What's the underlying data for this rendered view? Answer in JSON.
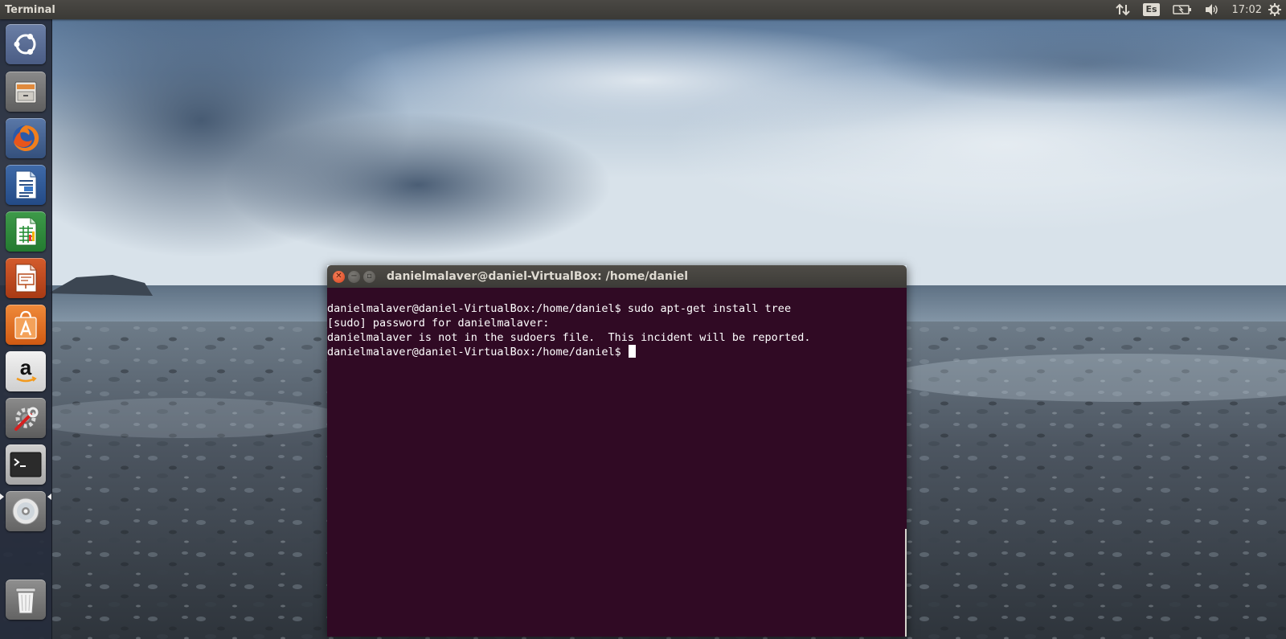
{
  "top_panel": {
    "app_title": "Terminal",
    "keyboard_layout": "Es",
    "clock": "17:02",
    "indicator_icons": [
      "network-updown-icon",
      "keyboard-layout-icon",
      "battery-icon",
      "volume-icon",
      "gear-icon"
    ]
  },
  "launcher": {
    "items": [
      {
        "name": "dash-home",
        "icon": "ubuntu-logo-icon"
      },
      {
        "name": "files",
        "icon": "file-cabinet-icon"
      },
      {
        "name": "firefox",
        "icon": "firefox-icon"
      },
      {
        "name": "libreoffice-writer",
        "icon": "writer-document-icon"
      },
      {
        "name": "libreoffice-calc",
        "icon": "calc-spreadsheet-icon"
      },
      {
        "name": "libreoffice-impress",
        "icon": "impress-presentation-icon"
      },
      {
        "name": "ubuntu-software",
        "icon": "shopping-bag-icon"
      },
      {
        "name": "amazon",
        "icon": "amazon-icon"
      },
      {
        "name": "system-settings",
        "icon": "settings-wrench-icon"
      },
      {
        "name": "terminal",
        "icon": "terminal-icon",
        "running": true
      },
      {
        "name": "optical-drive",
        "icon": "disc-icon"
      },
      {
        "name": "trash",
        "icon": "trash-icon"
      }
    ]
  },
  "terminal": {
    "window_title": "danielmalaver@daniel-VirtualBox: /home/daniel",
    "lines": [
      "danielmalaver@daniel-VirtualBox:/home/daniel$ sudo apt-get install tree",
      "[sudo] password for danielmalaver:",
      "danielmalaver is not in the sudoers file.  This incident will be reported.",
      "danielmalaver@daniel-VirtualBox:/home/daniel$ "
    ],
    "colors": {
      "background": "#300a24",
      "text": "#ffffff"
    }
  }
}
